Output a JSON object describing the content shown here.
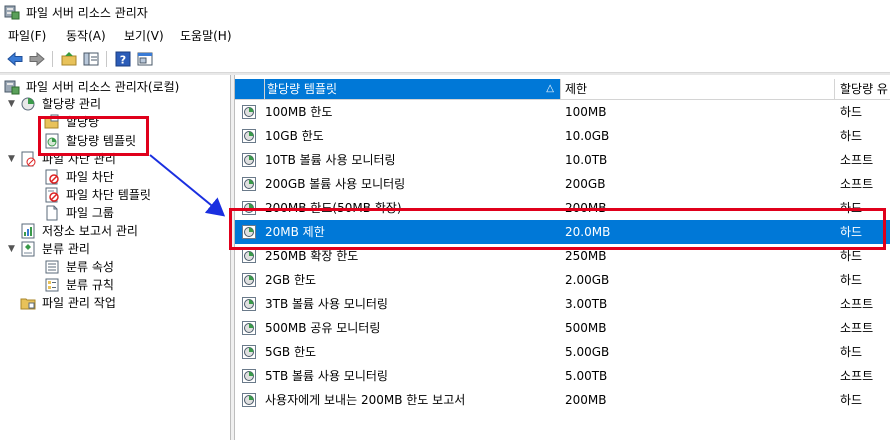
{
  "window": {
    "title": "파일 서버 리소스 관리자"
  },
  "menu": [
    "파일(F)",
    "동작(A)",
    "보기(V)",
    "도움말(H)"
  ],
  "toolbar": {
    "icons": [
      "back-icon",
      "forward-icon",
      "up-folder-icon",
      "show-hide-tree-icon",
      "help-icon",
      "properties-icon"
    ]
  },
  "tree": {
    "root": "파일 서버 리소스 관리자(로컬)",
    "quota_mgmt": "할당량 관리",
    "quotas": "할당량",
    "quota_templates": "할당량 템플릿",
    "file_screen_mgmt": "파일 차단 관리",
    "file_screens": "파일 차단",
    "file_screen_templates": "파일 차단 템플릿",
    "file_groups": "파일 그룹",
    "storage_reports": "저장소 보고서 관리",
    "classification_mgmt": "분류 관리",
    "class_props": "분류 속성",
    "class_rules": "분류 규칙",
    "file_mgmt_tasks": "파일 관리 작업"
  },
  "list": {
    "columns": [
      "할당량 템플릿",
      "제한",
      "할당량 유"
    ],
    "sort_glyph": "△",
    "rows": [
      {
        "name": "100MB 한도",
        "limit": "100MB",
        "type": "하드"
      },
      {
        "name": "10GB 한도",
        "limit": "10.0GB",
        "type": "하드"
      },
      {
        "name": "10TB 볼륨 사용 모니터링",
        "limit": "10.0TB",
        "type": "소프트"
      },
      {
        "name": "200GB 볼륨 사용 모니터링",
        "limit": "200GB",
        "type": "소프트"
      },
      {
        "name": "200MB 한도(50MB 확장)",
        "limit": "200MB",
        "type": "하드"
      },
      {
        "name": "20MB 제한",
        "limit": "20.0MB",
        "type": "하드"
      },
      {
        "name": "250MB 확장 한도",
        "limit": "250MB",
        "type": "하드"
      },
      {
        "name": "2GB 한도",
        "limit": "2.00GB",
        "type": "하드"
      },
      {
        "name": "3TB 볼륨 사용 모니터링",
        "limit": "3.00TB",
        "type": "소프트"
      },
      {
        "name": "500MB 공유 모니터링",
        "limit": "500MB",
        "type": "소프트"
      },
      {
        "name": "5GB 한도",
        "limit": "5.00GB",
        "type": "하드"
      },
      {
        "name": "5TB 볼륨 사용 모니터링",
        "limit": "5.00TB",
        "type": "소프트"
      },
      {
        "name": "사용자에게 보내는 200MB 한도 보고서",
        "limit": "200MB",
        "type": "하드"
      }
    ]
  },
  "colors": {
    "selection": "#0078d7",
    "highlight": "#e0001b",
    "arrow": "#1a2fe0"
  }
}
